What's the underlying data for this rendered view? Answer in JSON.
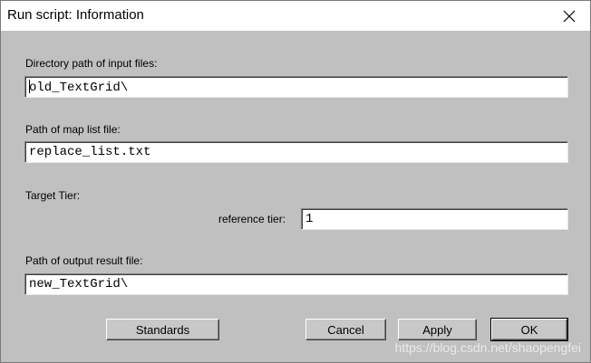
{
  "window": {
    "title": "Run script: Information"
  },
  "form": {
    "input_dir_label": "Directory path of input files:",
    "input_dir_value": "old_TextGrid\\",
    "map_list_label": "Path of map list file:",
    "map_list_value": "replace_list.txt",
    "target_tier_label": "Target Tier:",
    "reference_tier_label": "reference tier:",
    "reference_tier_value": "1",
    "output_label": "Path of output result file:",
    "output_value": "new_TextGrid\\"
  },
  "buttons": {
    "standards": "Standards",
    "cancel": "Cancel",
    "apply": "Apply",
    "ok": "OK"
  },
  "watermark": "https://blog.csdn.net/shaopengfei",
  "icons": {
    "close": "close-icon"
  }
}
